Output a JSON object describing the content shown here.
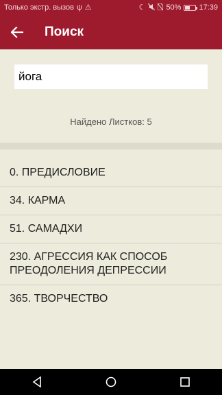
{
  "status_bar": {
    "carrier": "Только экстр. вызов",
    "battery": "50%",
    "battery_level": 0.5,
    "time": "17:39",
    "icons": [
      "usb-icon",
      "warning-icon",
      "moon-icon",
      "mute-icon",
      "no-sim-icon",
      "battery-icon"
    ]
  },
  "app_bar": {
    "title": "Поиск",
    "back_icon": "arrow-left-icon"
  },
  "search": {
    "value": "йога"
  },
  "found_text": "Найдено Листков: 5",
  "results": [
    "0. ПРЕДИСЛОВИЕ",
    "34. КАРМА",
    "51. САМАДХИ",
    "230. АГРЕССИЯ КАК СПОСОБ ПРЕОДОЛЕНИЯ ДЕПРЕССИИ",
    "365. ТВОРЧЕСТВО"
  ],
  "nav_bar": {
    "icons": [
      "back-triangle-icon",
      "home-circle-icon",
      "recents-square-icon"
    ]
  },
  "colors": {
    "primary": "#9e1b2e",
    "background": "#ecebdc"
  }
}
